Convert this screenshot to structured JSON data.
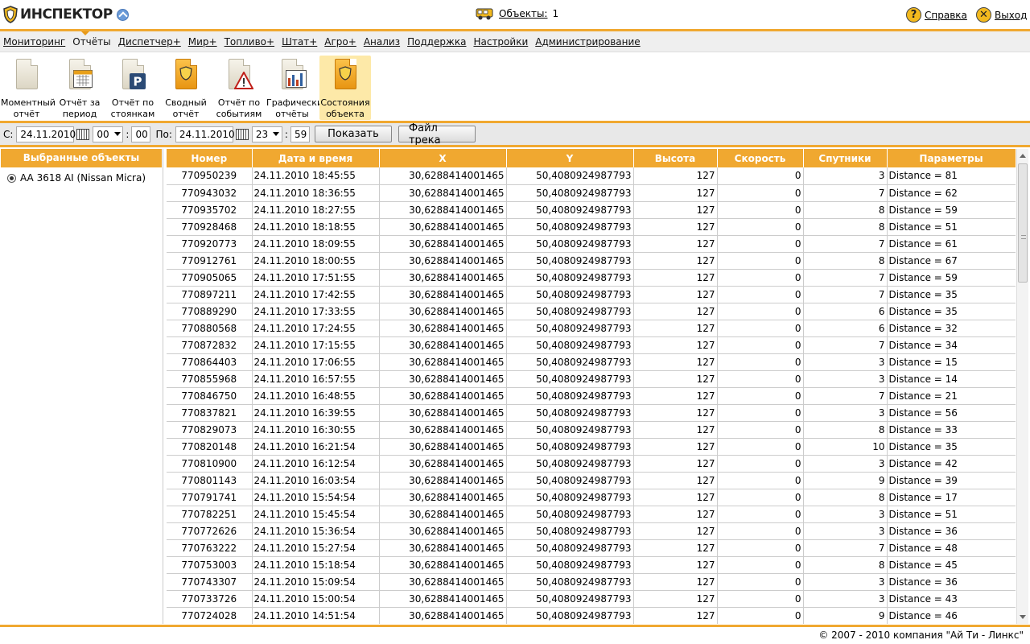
{
  "header": {
    "brand": "ИНСПЕКТОР",
    "objects_label": "Объекты:",
    "objects_count": "1",
    "help_label": "Справка",
    "exit_label": "Выход"
  },
  "menu": [
    {
      "label": "Мониторинг",
      "active": false
    },
    {
      "label": "Отчёты",
      "active": true
    },
    {
      "label": "Диспетчер+",
      "active": false
    },
    {
      "label": "Мир+",
      "active": false
    },
    {
      "label": "Топливо+",
      "active": false
    },
    {
      "label": "Штат+",
      "active": false
    },
    {
      "label": "Агро+",
      "active": false
    },
    {
      "label": "Анализ",
      "active": false
    },
    {
      "label": "Поддержка",
      "active": false
    },
    {
      "label": "Настройки",
      "active": false
    },
    {
      "label": "Администрирование",
      "active": false
    }
  ],
  "toolbar": [
    {
      "line1": "Моментный",
      "line2": "отчёт",
      "icon": "document-icon"
    },
    {
      "line1": "Отчёт за",
      "line2": "период",
      "icon": "calendar-report-icon"
    },
    {
      "line1": "Отчёт по",
      "line2": "стоянкам",
      "icon": "parking-report-icon"
    },
    {
      "line1": "Сводный",
      "line2": "отчёт",
      "icon": "summary-report-icon"
    },
    {
      "line1": "Отчёт по",
      "line2": "событиям",
      "icon": "events-report-icon"
    },
    {
      "line1": "Графические",
      "line2": "отчёты",
      "icon": "chart-report-icon"
    },
    {
      "line1": "Состояния",
      "line2": "объекта",
      "icon": "object-state-icon",
      "active": true
    }
  ],
  "filter": {
    "from_label": "С:",
    "from_date": "24.11.2010",
    "from_hour": "00",
    "from_minute": "00",
    "to_label": "По:",
    "to_date": "24.11.2010",
    "to_hour": "23",
    "to_minute": "59",
    "colon": ":",
    "show_button": "Показать",
    "track_button": "Файл трека"
  },
  "left_panel": {
    "title": "Выбранные объекты",
    "object": "AA 3618 AI (Nissan Micra)"
  },
  "table": {
    "columns": [
      "Номер",
      "Дата и время",
      "X",
      "Y",
      "Высота",
      "Скорость",
      "Спутники",
      "Параметры"
    ],
    "rows": [
      [
        "770950239",
        "24.11.2010 18:45:55",
        "30,6288414001465",
        "50,4080924987793",
        "127",
        "0",
        "3",
        "Distance = 81"
      ],
      [
        "770943032",
        "24.11.2010 18:36:55",
        "30,6288414001465",
        "50,4080924987793",
        "127",
        "0",
        "7",
        "Distance = 62"
      ],
      [
        "770935702",
        "24.11.2010 18:27:55",
        "30,6288414001465",
        "50,4080924987793",
        "127",
        "0",
        "8",
        "Distance = 59"
      ],
      [
        "770928468",
        "24.11.2010 18:18:55",
        "30,6288414001465",
        "50,4080924987793",
        "127",
        "0",
        "8",
        "Distance = 51"
      ],
      [
        "770920773",
        "24.11.2010 18:09:55",
        "30,6288414001465",
        "50,4080924987793",
        "127",
        "0",
        "7",
        "Distance = 61"
      ],
      [
        "770912761",
        "24.11.2010 18:00:55",
        "30,6288414001465",
        "50,4080924987793",
        "127",
        "0",
        "8",
        "Distance = 67"
      ],
      [
        "770905065",
        "24.11.2010 17:51:55",
        "30,6288414001465",
        "50,4080924987793",
        "127",
        "0",
        "7",
        "Distance = 59"
      ],
      [
        "770897211",
        "24.11.2010 17:42:55",
        "30,6288414001465",
        "50,4080924987793",
        "127",
        "0",
        "7",
        "Distance = 35"
      ],
      [
        "770889290",
        "24.11.2010 17:33:55",
        "30,6288414001465",
        "50,4080924987793",
        "127",
        "0",
        "6",
        "Distance = 35"
      ],
      [
        "770880568",
        "24.11.2010 17:24:55",
        "30,6288414001465",
        "50,4080924987793",
        "127",
        "0",
        "6",
        "Distance = 32"
      ],
      [
        "770872832",
        "24.11.2010 17:15:55",
        "30,6288414001465",
        "50,4080924987793",
        "127",
        "0",
        "7",
        "Distance = 34"
      ],
      [
        "770864403",
        "24.11.2010 17:06:55",
        "30,6288414001465",
        "50,4080924987793",
        "127",
        "0",
        "3",
        "Distance = 15"
      ],
      [
        "770855968",
        "24.11.2010 16:57:55",
        "30,6288414001465",
        "50,4080924987793",
        "127",
        "0",
        "3",
        "Distance = 14"
      ],
      [
        "770846750",
        "24.11.2010 16:48:55",
        "30,6288414001465",
        "50,4080924987793",
        "127",
        "0",
        "7",
        "Distance = 21"
      ],
      [
        "770837821",
        "24.11.2010 16:39:55",
        "30,6288414001465",
        "50,4080924987793",
        "127",
        "0",
        "3",
        "Distance = 56"
      ],
      [
        "770829073",
        "24.11.2010 16:30:55",
        "30,6288414001465",
        "50,4080924987793",
        "127",
        "0",
        "8",
        "Distance = 33"
      ],
      [
        "770820148",
        "24.11.2010 16:21:54",
        "30,6288414001465",
        "50,4080924987793",
        "127",
        "0",
        "10",
        "Distance = 35"
      ],
      [
        "770810900",
        "24.11.2010 16:12:54",
        "30,6288414001465",
        "50,4080924987793",
        "127",
        "0",
        "3",
        "Distance = 42"
      ],
      [
        "770801143",
        "24.11.2010 16:03:54",
        "30,6288414001465",
        "50,4080924987793",
        "127",
        "0",
        "9",
        "Distance = 39"
      ],
      [
        "770791741",
        "24.11.2010 15:54:54",
        "30,6288414001465",
        "50,4080924987793",
        "127",
        "0",
        "8",
        "Distance = 17"
      ],
      [
        "770782251",
        "24.11.2010 15:45:54",
        "30,6288414001465",
        "50,4080924987793",
        "127",
        "0",
        "3",
        "Distance = 51"
      ],
      [
        "770772626",
        "24.11.2010 15:36:54",
        "30,6288414001465",
        "50,4080924987793",
        "127",
        "0",
        "3",
        "Distance = 36"
      ],
      [
        "770763222",
        "24.11.2010 15:27:54",
        "30,6288414001465",
        "50,4080924987793",
        "127",
        "0",
        "7",
        "Distance = 48"
      ],
      [
        "770753003",
        "24.11.2010 15:18:54",
        "30,6288414001465",
        "50,4080924987793",
        "127",
        "0",
        "8",
        "Distance = 45"
      ],
      [
        "770743307",
        "24.11.2010 15:09:54",
        "30,6288414001465",
        "50,4080924987793",
        "127",
        "0",
        "3",
        "Distance = 36"
      ],
      [
        "770733726",
        "24.11.2010 15:00:54",
        "30,6288414001465",
        "50,4080924987793",
        "127",
        "0",
        "3",
        "Distance = 43"
      ],
      [
        "770724028",
        "24.11.2010 14:51:54",
        "30,6288414001465",
        "50,4080924987793",
        "127",
        "0",
        "9",
        "Distance = 46"
      ]
    ]
  },
  "footer": "© 2007 - 2010 компания \"Ай Ти - Линкс\"",
  "colors": {
    "accent": "#f0a830",
    "menu_bg": "#efefef",
    "filter_bg": "#e8e8e8"
  }
}
